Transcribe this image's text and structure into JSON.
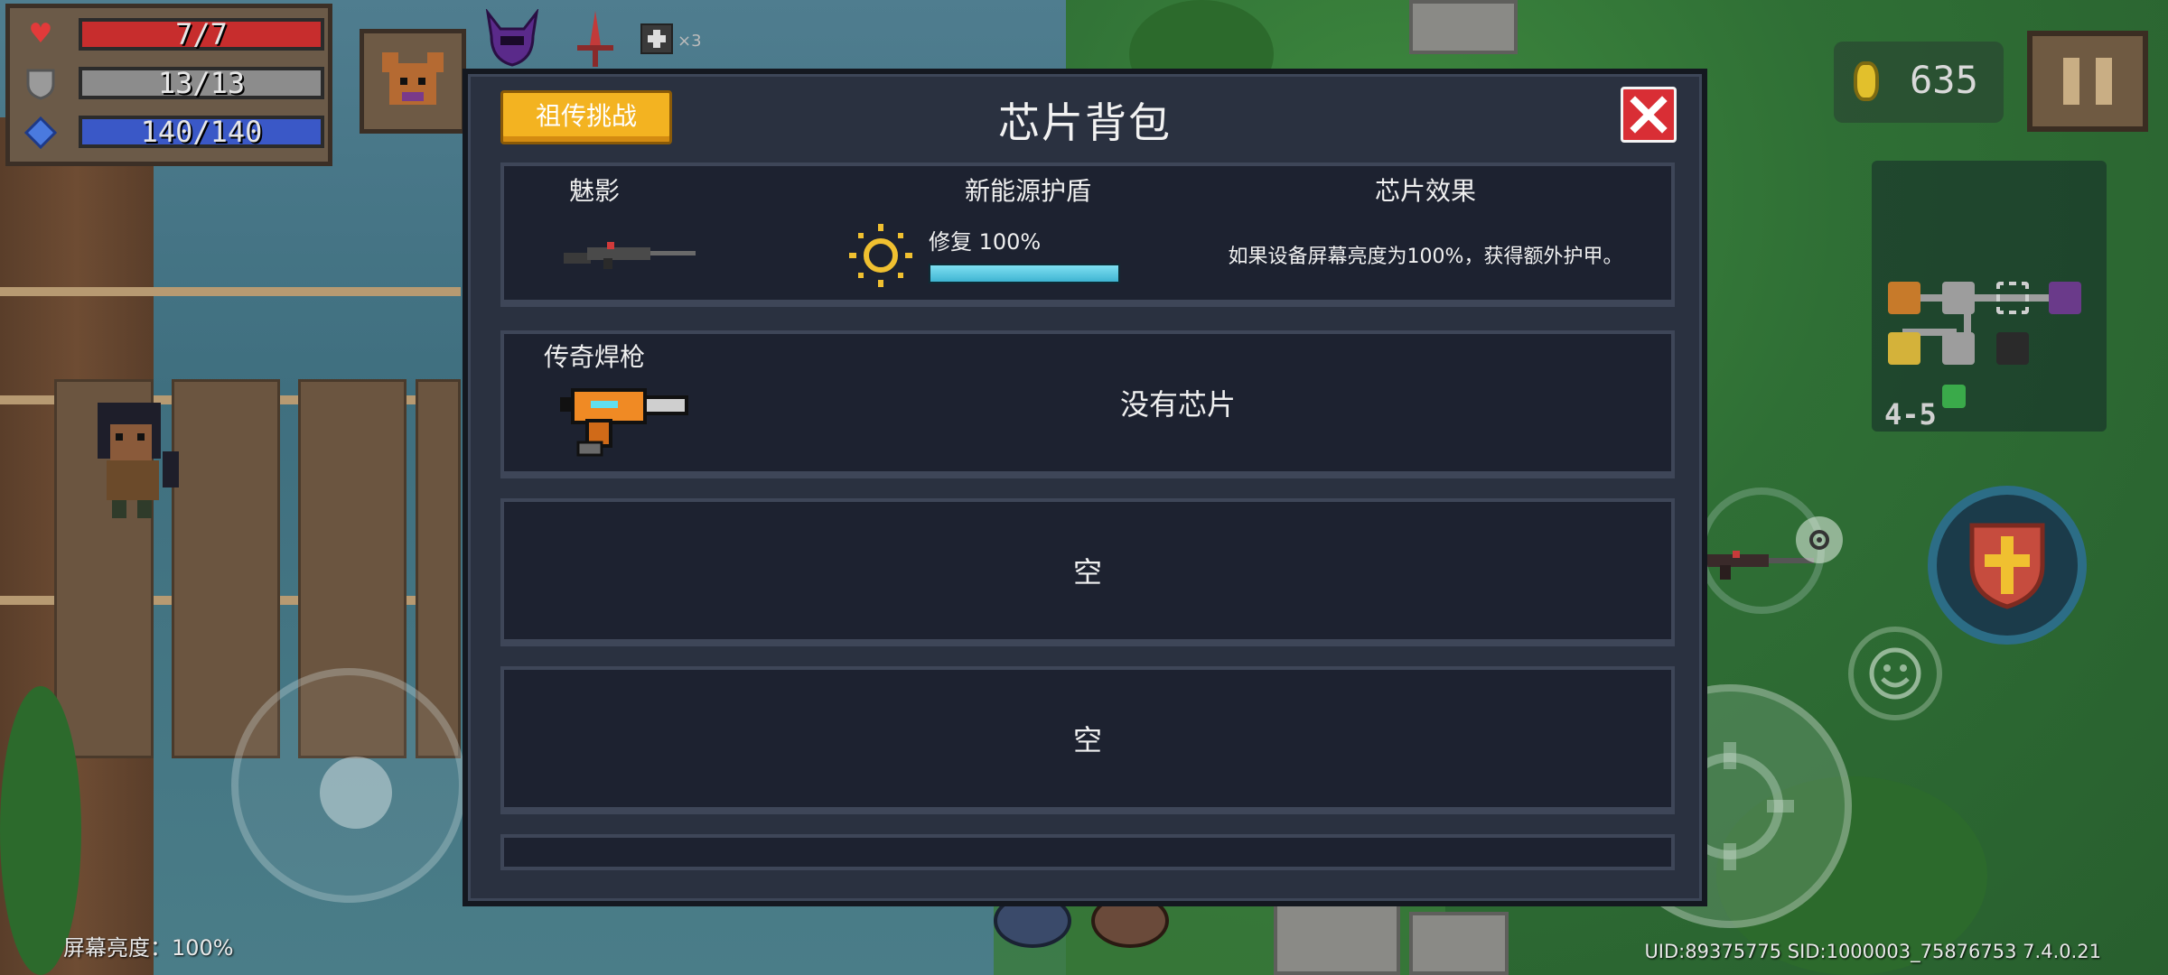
{
  "hud": {
    "health": {
      "icon": "heart-icon",
      "text": "7/7",
      "fraction": 1.0,
      "color": "#c72d2d"
    },
    "armor": {
      "icon": "shield-icon",
      "text": "13/13",
      "fraction": 1.0,
      "color": "#8c8c8c"
    },
    "energy": {
      "icon": "energy-gem-icon",
      "text": "140/140",
      "fraction": 1.0,
      "color": "#3a58c7"
    },
    "gold": "635",
    "minimap_level": "4-5",
    "screen_brightness": "屏幕亮度：100%",
    "uid_line": "UID:89375775 SID:1000003_75876753 7.4.0.21"
  },
  "dialog": {
    "title": "芯片背包",
    "legacy_button": "祖传挑战",
    "slots": [
      {
        "weapon_name": "魅影",
        "chip_name": "新能源护盾",
        "repair_text": "修复 100%",
        "repair_fraction": 1.0,
        "effect_header": "芯片效果",
        "effect_text": "如果设备屏幕亮度为100%，获得额外护甲。"
      },
      {
        "weapon_name": "传奇焊枪",
        "status": "没有芯片"
      },
      {
        "status": "空"
      },
      {
        "status": "空"
      }
    ]
  },
  "colors": {
    "dialog_bg": "#2a3140",
    "slot_bg": "#1d2230",
    "legacy_button": "#f3b321",
    "close_button": "#d92e35",
    "repair_bar": "#3fb4d2"
  }
}
